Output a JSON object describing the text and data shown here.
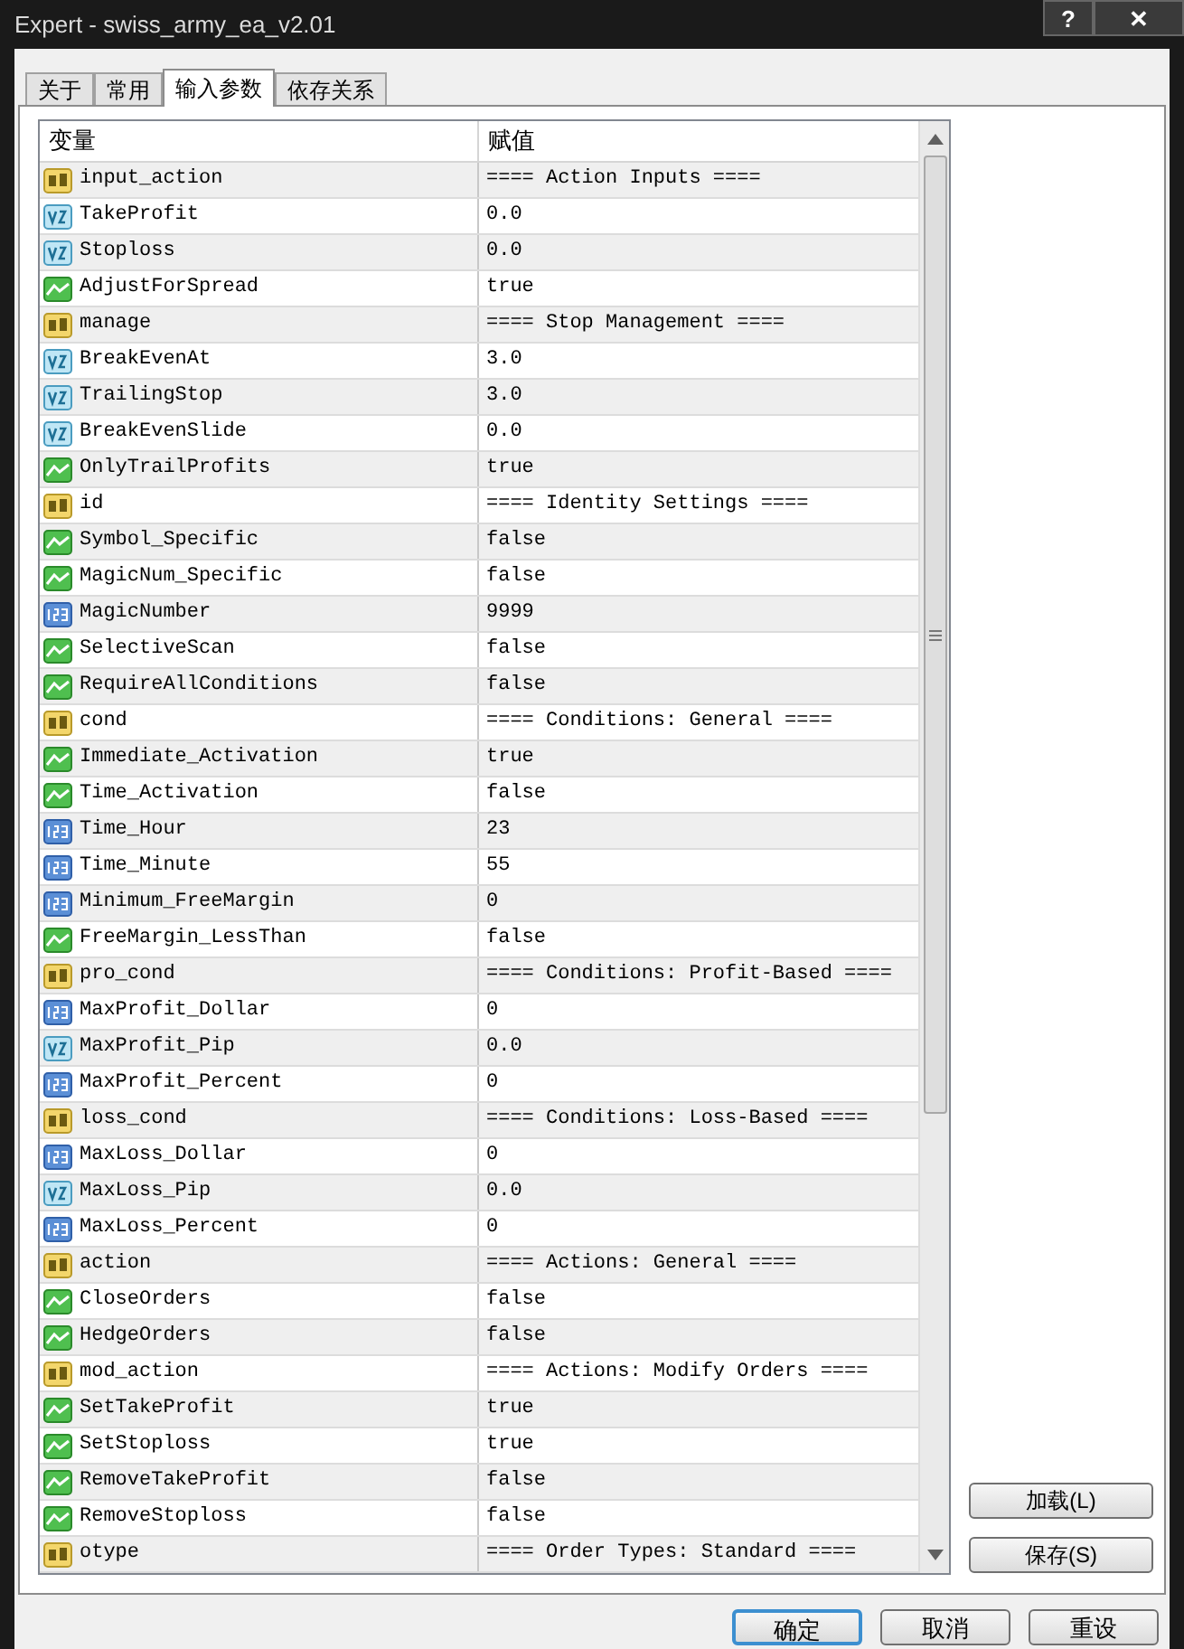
{
  "window": {
    "title": "Expert - swiss_army_ea_v2.01",
    "help": "?",
    "close": "✕"
  },
  "tabs": [
    {
      "label": "关于",
      "selected": false
    },
    {
      "label": "常用",
      "selected": false
    },
    {
      "label": "输入参数",
      "selected": true
    },
    {
      "label": "依存关系",
      "selected": false
    }
  ],
  "table": {
    "columns": [
      "变量",
      "赋值"
    ],
    "rows": [
      {
        "kind": "string",
        "name": "input_action",
        "value": "==== Action Inputs ===="
      },
      {
        "kind": "double",
        "name": "TakeProfit",
        "value": "0.0"
      },
      {
        "kind": "double",
        "name": "Stoploss",
        "value": "0.0"
      },
      {
        "kind": "bool",
        "name": "AdjustForSpread",
        "value": "true"
      },
      {
        "kind": "string",
        "name": "manage",
        "value": "==== Stop Management ===="
      },
      {
        "kind": "double",
        "name": "BreakEvenAt",
        "value": "3.0"
      },
      {
        "kind": "double",
        "name": "TrailingStop",
        "value": "3.0"
      },
      {
        "kind": "double",
        "name": "BreakEvenSlide",
        "value": "0.0"
      },
      {
        "kind": "bool",
        "name": "OnlyTrailProfits",
        "value": "true"
      },
      {
        "kind": "string",
        "name": "id",
        "value": "==== Identity Settings ===="
      },
      {
        "kind": "bool",
        "name": "Symbol_Specific",
        "value": "false"
      },
      {
        "kind": "bool",
        "name": "MagicNum_Specific",
        "value": "false"
      },
      {
        "kind": "int",
        "name": "MagicNumber",
        "value": "9999"
      },
      {
        "kind": "bool",
        "name": "SelectiveScan",
        "value": "false"
      },
      {
        "kind": "bool",
        "name": "RequireAllConditions",
        "value": "false"
      },
      {
        "kind": "string",
        "name": "cond",
        "value": "==== Conditions: General ===="
      },
      {
        "kind": "bool",
        "name": "Immediate_Activation",
        "value": "true"
      },
      {
        "kind": "bool",
        "name": "Time_Activation",
        "value": "false"
      },
      {
        "kind": "int",
        "name": "Time_Hour",
        "value": "23"
      },
      {
        "kind": "int",
        "name": "Time_Minute",
        "value": "55"
      },
      {
        "kind": "int",
        "name": "Minimum_FreeMargin",
        "value": "0"
      },
      {
        "kind": "bool",
        "name": "FreeMargin_LessThan",
        "value": "false"
      },
      {
        "kind": "string",
        "name": "pro_cond",
        "value": "==== Conditions: Profit-Based ===="
      },
      {
        "kind": "int",
        "name": "MaxProfit_Dollar",
        "value": "0"
      },
      {
        "kind": "double",
        "name": "MaxProfit_Pip",
        "value": "0.0"
      },
      {
        "kind": "int",
        "name": "MaxProfit_Percent",
        "value": "0"
      },
      {
        "kind": "string",
        "name": "loss_cond",
        "value": "==== Conditions: Loss-Based ===="
      },
      {
        "kind": "int",
        "name": "MaxLoss_Dollar",
        "value": "0"
      },
      {
        "kind": "double",
        "name": "MaxLoss_Pip",
        "value": "0.0"
      },
      {
        "kind": "int",
        "name": "MaxLoss_Percent",
        "value": "0"
      },
      {
        "kind": "string",
        "name": "action",
        "value": "==== Actions: General ===="
      },
      {
        "kind": "bool",
        "name": "CloseOrders",
        "value": "false"
      },
      {
        "kind": "bool",
        "name": "HedgeOrders",
        "value": "false"
      },
      {
        "kind": "string",
        "name": "mod_action",
        "value": "==== Actions: Modify Orders ===="
      },
      {
        "kind": "bool",
        "name": "SetTakeProfit",
        "value": "true"
      },
      {
        "kind": "bool",
        "name": "SetStoploss",
        "value": "true"
      },
      {
        "kind": "bool",
        "name": "RemoveTakeProfit",
        "value": "false"
      },
      {
        "kind": "bool",
        "name": "RemoveStoploss",
        "value": "false"
      },
      {
        "kind": "string",
        "name": "otype",
        "value": "==== Order Types: Standard ===="
      }
    ]
  },
  "side_buttons": [
    "加载(L)",
    "保存(S)"
  ],
  "buttons": [
    {
      "label": "确定",
      "default": true
    },
    {
      "label": "取消",
      "default": false
    },
    {
      "label": "重设",
      "default": false
    }
  ]
}
